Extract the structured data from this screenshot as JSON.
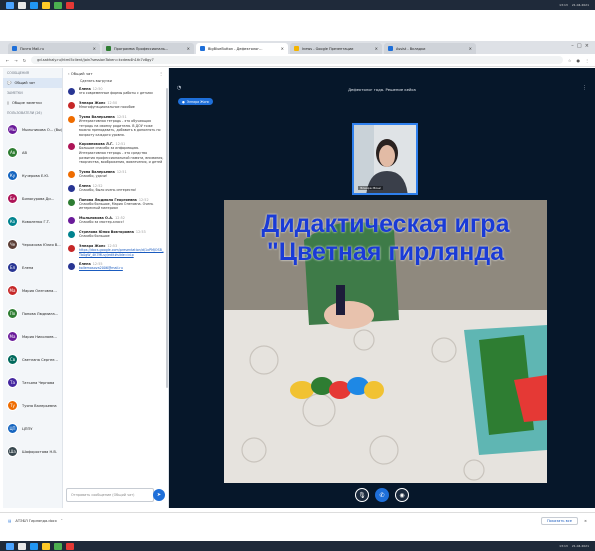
{
  "taskbar": {
    "clock_time": "13:13",
    "clock_date": "21.04.2021"
  },
  "tabs": [
    {
      "label": "Почта Mail.ru",
      "color": "#1e6fd9"
    },
    {
      "label": "Программа Профессиональ...",
      "color": "#2e7d32"
    },
    {
      "label": "BigBlueButton - Дефектолог...",
      "color": "#1e6fd9",
      "active": true
    },
    {
      "label": "Іnews - Google Презентации",
      "color": "#f4b400"
    },
    {
      "label": "Assist - Вкладки",
      "color": "#1e6fd9"
    }
  ],
  "address": {
    "url": "gd.sakhaly.ru/html5client/join?sessionToken=kcdew4h1tk7v8gy7"
  },
  "users_panel": {
    "messages_title": "СООБЩЕНИЯ",
    "public_chat": "Общий чат",
    "notes_title": "ЗАМЕТКИ",
    "shared_notes": "Общие заметки",
    "users_title": "ПОЛЬЗОВАТЕЛИ (26)",
    "users": [
      {
        "initials": "Мы",
        "name": "Мыльникова О... (Вы)",
        "color": "#6a1b9a"
      },
      {
        "initials": "Ав",
        "name": "АВ",
        "color": "#2e7d32"
      },
      {
        "initials": "Ку",
        "name": "Кучерова Е.Ю.",
        "color": "#1565c0"
      },
      {
        "initials": "Би",
        "name": "Билокурова Ди...",
        "color": "#ad1457"
      },
      {
        "initials": "Ко",
        "name": "Коваленко Г.Т.",
        "color": "#00838f"
      },
      {
        "initials": "Че",
        "name": "Черкасова Юлия В...",
        "color": "#5d4037"
      },
      {
        "initials": "Ел",
        "name": "Елена",
        "color": "#283593"
      },
      {
        "initials": "Ма",
        "name": "Мария Олеговна...",
        "color": "#c62828"
      },
      {
        "initials": "По",
        "name": "Попова Людмила...",
        "color": "#2e7d32"
      },
      {
        "initials": "Ма",
        "name": "Мария Николаев...",
        "color": "#6a1b9a"
      },
      {
        "initials": "Св",
        "name": "Светлана Сергее...",
        "color": "#00695c"
      },
      {
        "initials": "Та",
        "name": "Татьяна Чернова",
        "color": "#4527a0"
      },
      {
        "initials": "Ту",
        "name": "Туяна Валерьевна",
        "color": "#ef6c00"
      },
      {
        "initials": "ЦП",
        "name": "ЦППУ",
        "color": "#1565c0"
      },
      {
        "initials": "Ша",
        "name": "Шафоростова Н.В.",
        "color": "#37474f"
      }
    ]
  },
  "chat": {
    "title": "Общий чат",
    "first_line": "Сделать выгрузки",
    "messages": [
      {
        "name": "Елена",
        "time": "12:50",
        "text": "это современные формы работы с детьми",
        "color": "#283593"
      },
      {
        "name": "Элнара Жонс",
        "time": "12:50",
        "text": "Многофункциональное пособие",
        "color": "#c62828"
      },
      {
        "name": "Туяна Валерьевна",
        "time": "12:51",
        "text": "Интерактивная тетрадь - это обучающая тетрадь на своему родителю. В ДОУ тоже можно преподавать, добавить в дополнять по возрасту каждого уровня.",
        "color": "#ef6c00"
      },
      {
        "name": "Коровникова Л.Г.",
        "time": "12:51",
        "text": "Большое спасибо за информацию. Интерактивная тетрадь - это средство развития профессиональной памяти, внимания, творчества, воображения, вовлечения, и детей",
        "color": "#ad1457"
      },
      {
        "name": "Туяна Валерьевна",
        "time": "12:51",
        "text": "Спасибо, удачи!",
        "color": "#ef6c00"
      },
      {
        "name": "Елена",
        "time": "12:52",
        "text": "Спасибо, было очень интересно!",
        "color": "#283593"
      },
      {
        "name": "Попова Людмила Георгиевна",
        "time": "12:52",
        "text": "Спасибо большое, Мария Олеговна. Очень интересный материал",
        "color": "#2e7d32"
      },
      {
        "name": "Мыльникова О.А.",
        "time": "12:52",
        "text": "Спасибо за мастер-класс!",
        "color": "#6a1b9a"
      },
      {
        "name": "Стрелова Юлия Викторовна",
        "time": "12:53",
        "text": "Спасибо большое",
        "color": "#00838f"
      },
      {
        "name": "Элнара Жонс",
        "time": "12:53",
        "text": "https://docs.google.com/presentation/d/1xPMJOSB_Tb0gW_4K7MLsy/edit#slide=id.p",
        "color": "#c62828",
        "link": true
      },
      {
        "name": "Елена",
        "time": "12:55",
        "text": "kollemosova2006@mail.ru",
        "color": "#283593",
        "link": true
      }
    ],
    "input_placeholder": "Отправить сообщение (Общий чат)"
  },
  "main": {
    "title": "Дефектолог года. Решение кейса",
    "recording_label": "Элнара Жонс",
    "webcam_name": "Элнара Жонс",
    "slide_title_line1": "Дидактическая игра",
    "slide_title_line2": "\"Цветная гирлянда"
  },
  "downloads": {
    "file_name": "АТЭБЛ Гирлянда.docx",
    "show_all": "Показать все"
  }
}
